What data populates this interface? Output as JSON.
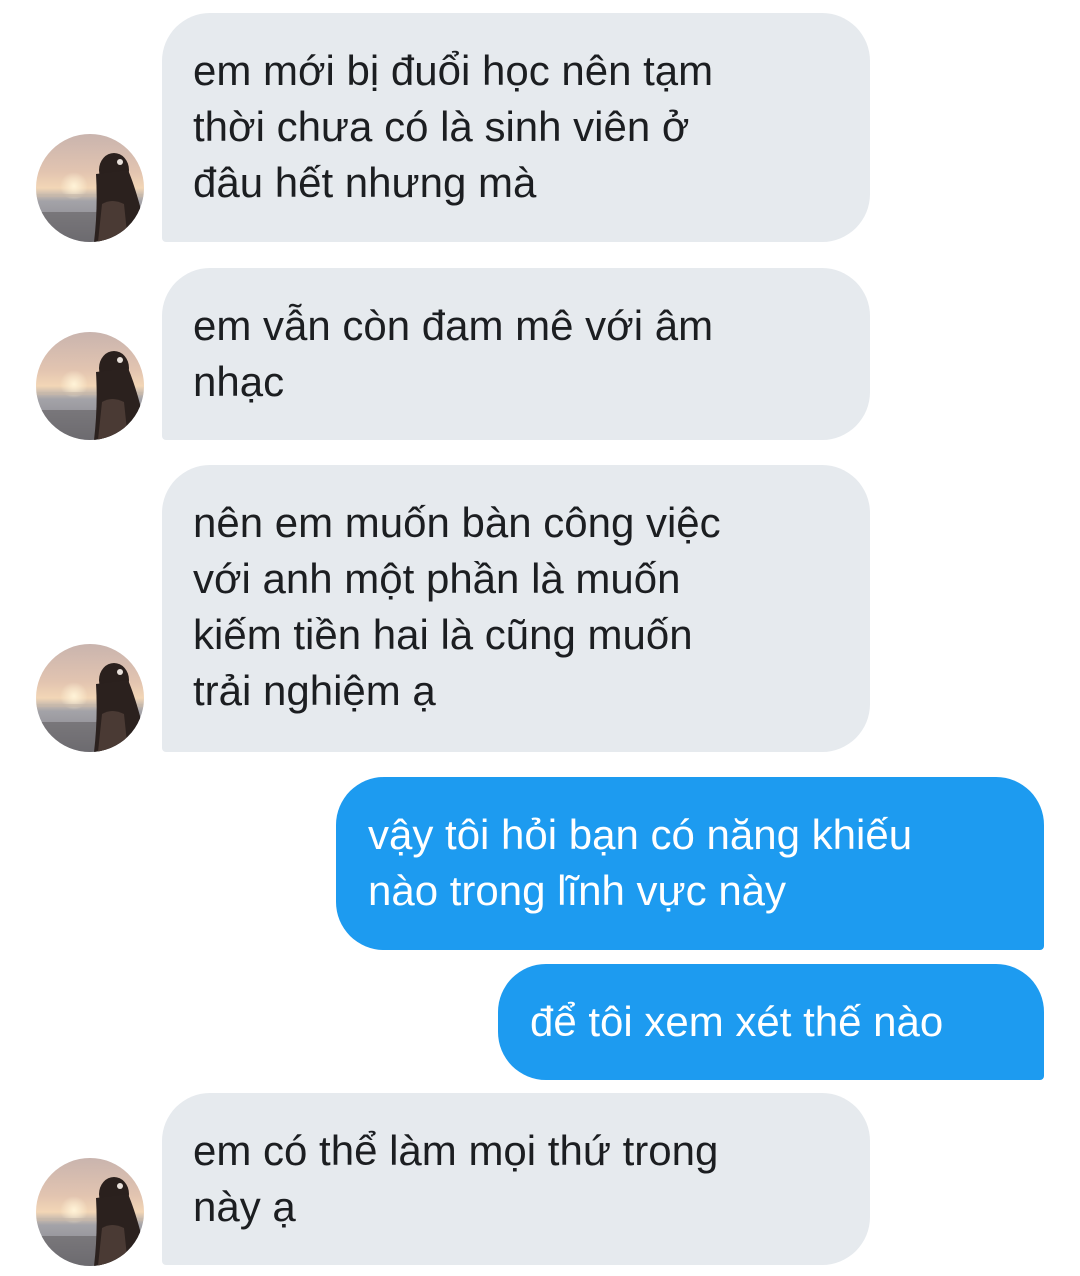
{
  "conversation": {
    "messages": [
      {
        "direction": "incoming",
        "text": "em mới bị đuổi học nên tạm\nthời chưa có là sinh viên ở\nđâu hết nhưng mà"
      },
      {
        "direction": "incoming",
        "text": "em vẫn còn đam mê với âm\nnhạc"
      },
      {
        "direction": "incoming",
        "text": "nên em muốn bàn công việc\nvới anh một phần là muốn\nkiếm tiền hai là cũng muốn\ntrải nghiệm ạ"
      },
      {
        "direction": "outgoing",
        "text": "vậy tôi hỏi bạn có năng khiếu\nnào trong lĩnh vực này"
      },
      {
        "direction": "outgoing",
        "text": "để tôi xem xét thế nào"
      },
      {
        "direction": "incoming",
        "text": "em có thể làm mọi thứ trong\nnày ạ"
      }
    ],
    "avatar_icon": "profile-photo-girl-sunset",
    "colors": {
      "incoming_bubble": "#e6eaee",
      "incoming_text": "#1c1e21",
      "outgoing_bubble": "#1d9bf0",
      "outgoing_text": "#ffffff"
    }
  }
}
